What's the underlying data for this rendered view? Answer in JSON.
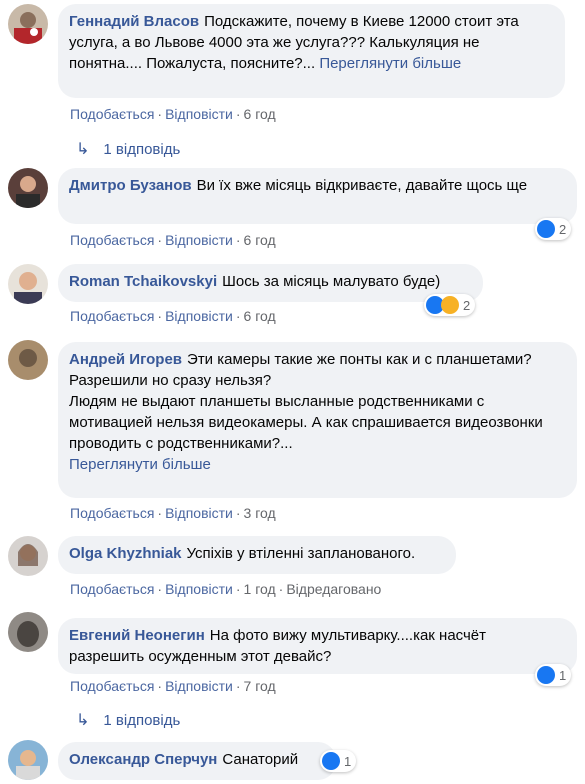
{
  "comments": [
    {
      "author": "Геннадий Власов",
      "text": "Подскажите, почему в Киеве 12000 стоит эта услуга, а во Львове 4000 эта же услуга??? Калькуляция не понятна.... Пожалуста, поясните?...",
      "see_more": "Переглянути більше",
      "like_label": "Подобається",
      "reply_label": "Відповісти",
      "time": "6 год",
      "replies_label": "1 відповідь"
    },
    {
      "author": "Дмитро Бузанов",
      "text": "Ви їх вже місяць відкриваєте, давайте щось ще",
      "like_label": "Подобається",
      "reply_label": "Відповісти",
      "time": "6 год",
      "reaction_count": "2",
      "reaction_icons": [
        "like-icon"
      ]
    },
    {
      "author": "Roman Tchaikovskyi",
      "text": "Шось за місяць малувато буде)",
      "like_label": "Подобається",
      "reply_label": "Відповісти",
      "time": "6 год",
      "reaction_count": "2",
      "reaction_icons": [
        "like-icon",
        "haha-icon"
      ]
    },
    {
      "author": "Андрей Игорев",
      "text_lines": [
        "Эти камеры такие же понты как и с планшетами?",
        "Разрешили но сразу нельзя?",
        "Людям не выдают планшеты высланные родственниками с мотивацией нельзя видеокамеры. А как спрашивается видеозвонки проводить с родственниками?..."
      ],
      "see_more": "Переглянути більше",
      "like_label": "Подобається",
      "reply_label": "Відповісти",
      "time": "3 год"
    },
    {
      "author": "Olga Khyzhniak",
      "text": "Успіхів у втіленні запланованого.",
      "like_label": "Подобається",
      "reply_label": "Відповісти",
      "time": "1 год",
      "edited_label": "Відредаговано"
    },
    {
      "author": "Евгений Неонегин",
      "text": "На фото вижу мультиварку....как насчёт разрешить осужденным этот девайс?",
      "like_label": "Подобається",
      "reply_label": "Відповісти",
      "time": "7 год",
      "reaction_count": "1",
      "reaction_icons": [
        "like-icon"
      ],
      "replies_label": "1 відповідь"
    },
    {
      "author": "Олександр Сперчун",
      "text": "Санаторий",
      "reaction_count": "1",
      "reaction_icons": [
        "like-icon"
      ]
    }
  ],
  "colors": {
    "author_link": "#385898",
    "bubble_bg": "#f0f2f5",
    "meta_text": "#65676b",
    "like_blue": "#1877f2",
    "haha_yellow": "#f7b125"
  }
}
